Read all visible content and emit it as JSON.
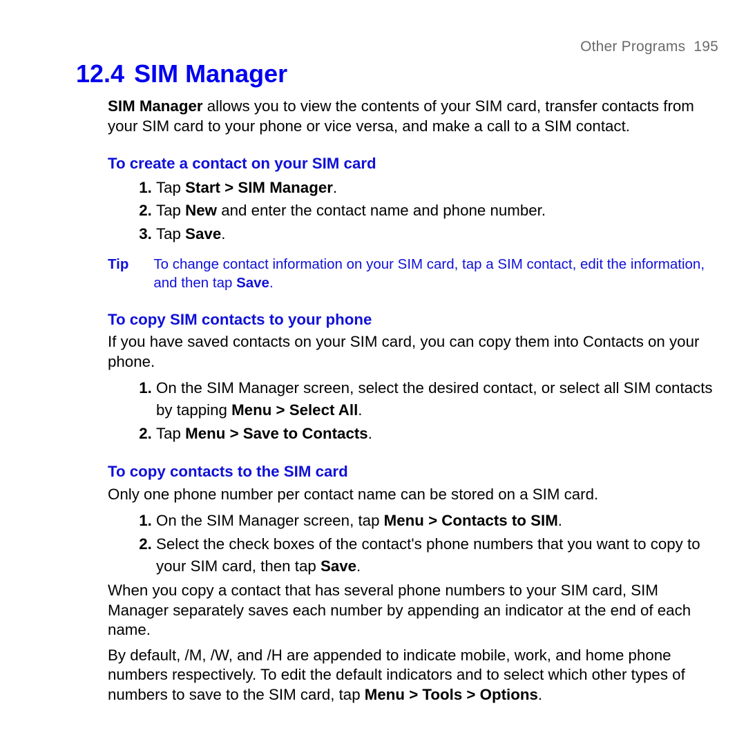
{
  "header": {
    "chapter": "Other Programs",
    "page": "195"
  },
  "title": {
    "number": "12.4",
    "text": "SIM Manager"
  },
  "intro": {
    "lead_bold": "SIM Manager",
    "rest": " allows you to view the contents of your SIM card, transfer contacts from your SIM card to your phone or vice versa, and make a call to a SIM contact."
  },
  "section1": {
    "heading": "To create a contact on your SIM card",
    "step1_pre": "Tap ",
    "step1_bold": "Start > SIM Manager",
    "step1_post": ".",
    "step2_pre": "Tap ",
    "step2_bold": "New",
    "step2_post": " and enter the contact name and phone number.",
    "step3_pre": "Tap ",
    "step3_bold": "Save",
    "step3_post": "."
  },
  "tip": {
    "label": "Tip",
    "text_pre": "To change contact information on your SIM card, tap a SIM contact, edit the information, and then tap ",
    "text_bold": "Save",
    "text_post": "."
  },
  "section2": {
    "heading": "To copy SIM contacts to your phone",
    "intro": "If you have saved contacts on your SIM card, you can copy them into Contacts on your phone.",
    "step1_pre": "On the SIM Manager screen, select the desired contact, or select all SIM contacts by tapping ",
    "step1_bold": "Menu > Select All",
    "step1_post": ".",
    "step2_pre": "Tap ",
    "step2_bold": "Menu > Save to Contacts",
    "step2_post": "."
  },
  "section3": {
    "heading": "To copy contacts to the SIM card",
    "intro": "Only one phone number per contact name can be stored on a SIM card.",
    "step1_pre": "On the SIM Manager screen, tap ",
    "step1_bold": "Menu > Contacts to SIM",
    "step1_post": ".",
    "step2_pre": "Select the check boxes of the contact's phone numbers that you want to copy to your SIM card, then tap ",
    "step2_bold": "Save",
    "step2_post": ".",
    "para1": "When you copy a contact that has several phone numbers to your SIM card, SIM Manager separately saves each number by appending an indicator at the end of each name.",
    "para2_pre": "By default, /M, /W, and /H are appended to indicate mobile, work, and home phone numbers respectively. To edit the default indicators and to select which other types of numbers to save to the SIM card, tap ",
    "para2_bold": "Menu > Tools > Options",
    "para2_post": "."
  }
}
